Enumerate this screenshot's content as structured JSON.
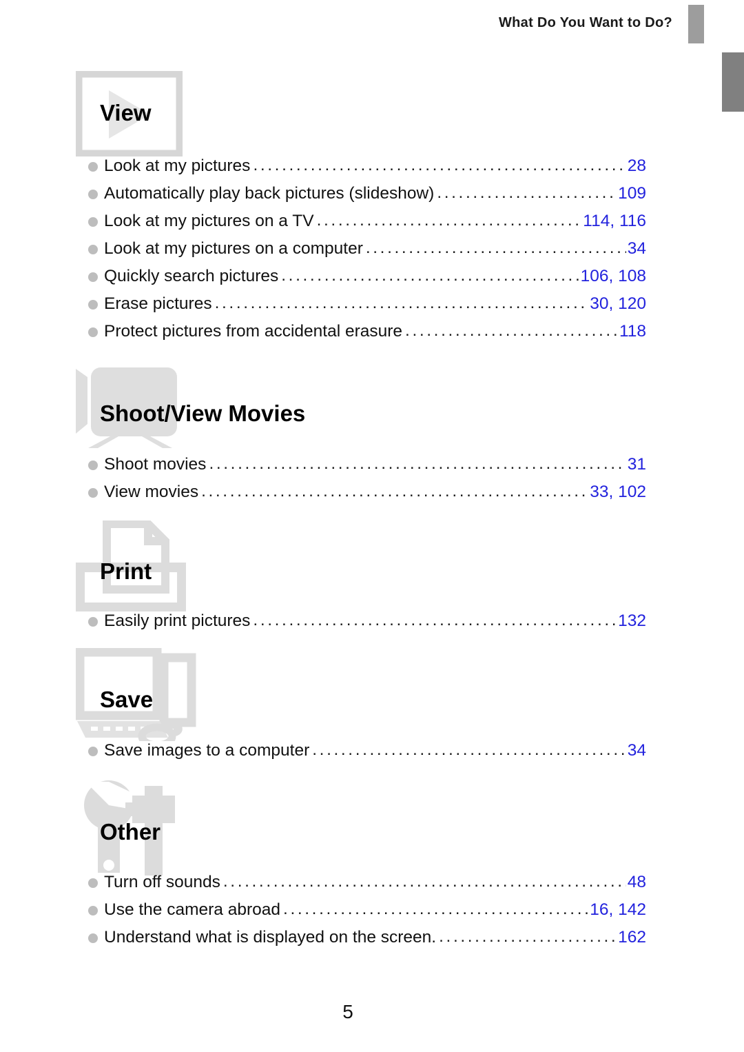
{
  "header": {
    "title": "What Do You Want to Do?",
    "tab_marker_primary_color": "#9d9d9d",
    "tab_marker_secondary_color": "#808080"
  },
  "colors": {
    "page_number_accent": "#2222dd",
    "bullet": "#bdbdbd",
    "icon_gray": "#dcdcdc",
    "icon_frame": "#d4d4d4",
    "text": "#111111"
  },
  "sections": [
    {
      "title": "View",
      "icon": "play-screen-icon",
      "entries": [
        {
          "label": "Look at my pictures",
          "page": "28"
        },
        {
          "label": "Automatically play back pictures (slideshow)",
          "page": "109"
        },
        {
          "label": "Look at my pictures on a TV",
          "page": "114, 116"
        },
        {
          "label": "Look at my pictures on a computer",
          "page": "34"
        },
        {
          "label": "Quickly search pictures",
          "page": "106, 108"
        },
        {
          "label": "Erase pictures",
          "page": "30, 120"
        },
        {
          "label": "Protect pictures from accidental erasure",
          "page": "118"
        }
      ]
    },
    {
      "title": "Shoot/View Movies",
      "icon": "movie-camera-icon",
      "entries": [
        {
          "label": "Shoot movies",
          "page": "31"
        },
        {
          "label": "View movies",
          "page": "33, 102"
        }
      ]
    },
    {
      "title": "Print",
      "icon": "printer-icon",
      "entries": [
        {
          "label": "Easily print pictures",
          "page": "132"
        }
      ]
    },
    {
      "title": "Save",
      "icon": "computer-icon",
      "entries": [
        {
          "label": "Save images to a computer",
          "page": "34"
        }
      ]
    },
    {
      "title": "Other",
      "icon": "tools-icon",
      "entries": [
        {
          "label": "Turn off sounds",
          "page": "48"
        },
        {
          "label": "Use the camera abroad",
          "page": "16, 142"
        },
        {
          "label": "Understand what is displayed on the screen.",
          "page": "162"
        }
      ]
    }
  ],
  "footer": {
    "page_number": "5"
  }
}
